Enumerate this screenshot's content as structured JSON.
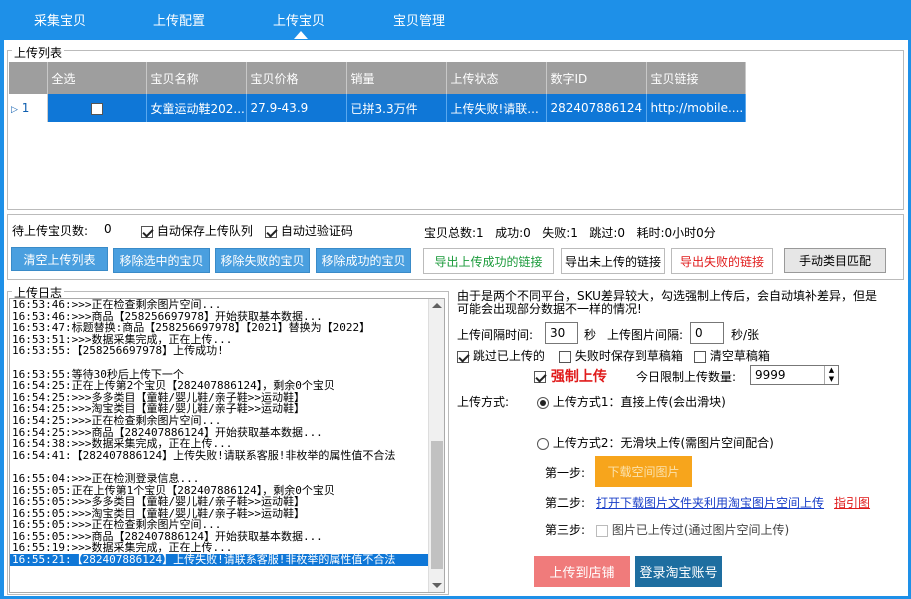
{
  "nav": {
    "tabs": [
      {
        "label": "采集宝贝"
      },
      {
        "label": "上传配置"
      },
      {
        "label": "上传宝贝"
      },
      {
        "label": "宝贝管理"
      }
    ]
  },
  "upload_list": {
    "title": "上传列表",
    "columns": [
      "全选",
      "宝贝名称",
      "宝贝价格",
      "销量",
      "上传状态",
      "数字ID",
      "宝贝链接"
    ],
    "rows": [
      {
        "row_num": "1",
        "checked": false,
        "name": "女童运动鞋202...",
        "price": "27.9-43.9",
        "sales": "已拼3.3万件",
        "status": "上传失败!请联...",
        "num_id": "282407886124",
        "link": "http://mobile...."
      }
    ]
  },
  "toolbar": {
    "pending_label": "待上传宝贝数:",
    "pending_value": "0",
    "auto_save_queue": "自动保存上传队列",
    "auto_captcha": "自动过验证码",
    "stats": "宝贝总数:1   成功:0   失败:1   跳过:0   耗时:0小时0分",
    "buttons": {
      "clear_list": "清空上传列表",
      "remove_selected": "移除选中的宝贝",
      "remove_failed": "移除失败的宝贝",
      "remove_success": "移除成功的宝贝",
      "export_success": "导出上传成功的链接",
      "export_pending": "导出未上传的链接",
      "export_failed": "导出失败的链接",
      "manual_category": "手动类目匹配"
    }
  },
  "log": {
    "title": "上传日志",
    "lines": [
      "16:53:46:>>>正在检查剩余图片空间...",
      "16:53:46:>>>商品【258256697978】开始获取基本数据...",
      "16:53:47:标题替换:商品【258256697978】【2021】替换为【2022】",
      "16:53:51:>>>数据采集完成，正在上传...",
      "16:53:55:【258256697978】上传成功!",
      "",
      "16:53:55:等待30秒后上传下一个",
      "16:54:25:正在上传第2个宝贝【282407886124】，剩余0个宝贝",
      "16:54:25:>>>多多类目【童鞋/婴儿鞋/亲子鞋>>运动鞋】",
      "16:54:25:>>>淘宝类目【童鞋/婴儿鞋/亲子鞋>>运动鞋】",
      "16:54:25:>>>正在检查剩余图片空间...",
      "16:54:25:>>>商品【282407886124】开始获取基本数据...",
      "16:54:38:>>>数据采集完成，正在上传...",
      "16:54:41:【282407886124】上传失败!请联系客服!非枚举的属性值不合法",
      "",
      "16:55:04:>>>正在检测登录信息...",
      "16:55:05:正在上传第1个宝贝【282407886124】，剩余0个宝贝",
      "16:55:05:>>>多多类目【童鞋/婴儿鞋/亲子鞋>>运动鞋】",
      "16:55:05:>>>淘宝类目【童鞋/婴儿鞋/亲子鞋>>运动鞋】",
      "16:55:05:>>>正在检查剩余图片空间...",
      "16:55:05:>>>商品【282407886124】开始获取基本数据...",
      "16:55:19:>>>数据采集完成，正在上传...",
      "16:55:21:【282407886124】上传失败!请联系客服!非枚举的属性值不合法"
    ],
    "selected_index": 22
  },
  "settings": {
    "notice": "由于是两个不同平台，SKU差异较大，勾选强制上传后，会自动填补差异，但是可能会出现部分数据不一样的情况!",
    "interval_label": "上传间隔时间:",
    "interval_value": "30",
    "interval_unit": "秒",
    "img_interval_label": "上传图片间隔:",
    "img_interval_value": "0",
    "img_interval_unit": "秒/张",
    "skip_uploaded": "跳过已上传的",
    "save_draft_on_fail": "失败时保存到草稿箱",
    "clear_drafts": "清空草稿箱",
    "force_upload": "强制上传",
    "daily_limit_label": "今日限制上传数量:",
    "daily_limit_value": "9999",
    "method_label": "上传方式:",
    "method1": "上传方式1：直接上传(会出滑块)",
    "method2": "上传方式2：无滑块上传(需图片空间配合)",
    "step1_label": "第一步:",
    "step1_button": "下载空间图片",
    "step2_label": "第二步:",
    "step2_link": "打开下载图片文件夹利用淘宝图片空间上传",
    "step2_guide": "指引图",
    "step3_label": "第三步:",
    "step3_check": "图片已上传过(通过图片空间上传)",
    "upload_to_store": "上传到店铺",
    "login_taobao": "登录淘宝账号"
  }
}
